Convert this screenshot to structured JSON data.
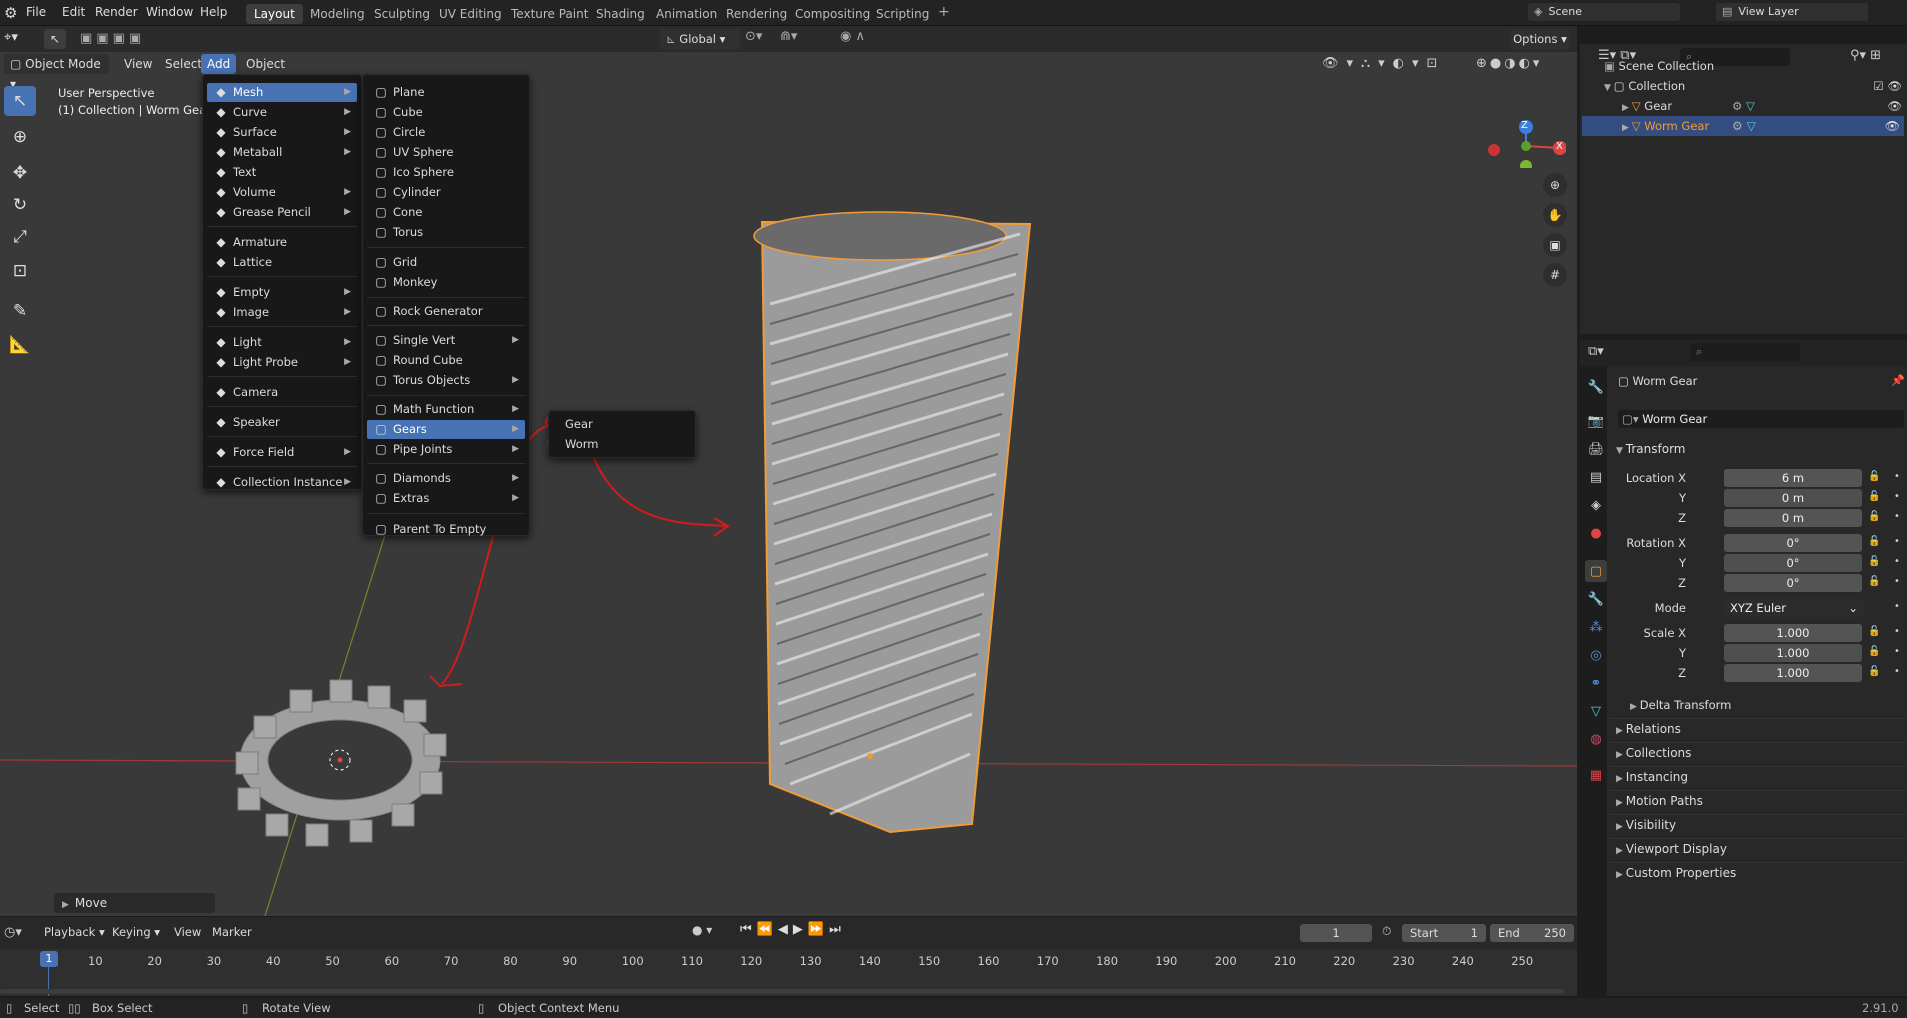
{
  "topbar": {
    "menus": [
      "File",
      "Edit",
      "Render",
      "Window",
      "Help"
    ],
    "workspaces": [
      "Layout",
      "Modeling",
      "Sculpting",
      "UV Editing",
      "Texture Paint",
      "Shading",
      "Animation",
      "Rendering",
      "Compositing",
      "Scripting"
    ],
    "active_workspace": "Layout",
    "scene": "Scene",
    "view_layer": "View Layer"
  },
  "viewport_header": {
    "mode": "Object Mode",
    "menus": [
      "View",
      "Select",
      "Add",
      "Object"
    ],
    "transform_orientation": "Global",
    "options": "Options"
  },
  "viewport": {
    "perspective": "User Perspective",
    "collection_info": "(1) Collection | Worm Gear",
    "operator_panel": "Move",
    "axes": {
      "z": "Z",
      "x": "X"
    }
  },
  "add_menu": {
    "items": [
      {
        "label": "Mesh",
        "icon": "mesh-icon",
        "submenu": true
      },
      {
        "label": "Curve",
        "icon": "curve-icon",
        "submenu": true
      },
      {
        "label": "Surface",
        "icon": "surface-icon",
        "submenu": true
      },
      {
        "label": "Metaball",
        "icon": "metaball-icon",
        "submenu": true
      },
      {
        "label": "Text",
        "icon": "text-icon",
        "submenu": false
      },
      {
        "label": "Volume",
        "icon": "volume-icon",
        "submenu": true
      },
      {
        "label": "Grease Pencil",
        "icon": "grease-pencil-icon",
        "submenu": true
      },
      {
        "label": "Armature",
        "icon": "armature-icon",
        "submenu": false
      },
      {
        "label": "Lattice",
        "icon": "lattice-icon",
        "submenu": false
      },
      {
        "label": "Empty",
        "icon": "empty-icon",
        "submenu": true
      },
      {
        "label": "Image",
        "icon": "image-icon",
        "submenu": true
      },
      {
        "label": "Light",
        "icon": "light-icon",
        "submenu": true
      },
      {
        "label": "Light Probe",
        "icon": "light-probe-icon",
        "submenu": true
      },
      {
        "label": "Camera",
        "icon": "camera-icon",
        "submenu": false
      },
      {
        "label": "Speaker",
        "icon": "speaker-icon",
        "submenu": false
      },
      {
        "label": "Force Field",
        "icon": "force-field-icon",
        "submenu": true
      },
      {
        "label": "Collection Instance",
        "icon": "collection-instance-icon",
        "submenu": true
      }
    ]
  },
  "mesh_menu": {
    "items": [
      {
        "label": "Plane",
        "submenu": false
      },
      {
        "label": "Cube",
        "submenu": false
      },
      {
        "label": "Circle",
        "submenu": false
      },
      {
        "label": "UV Sphere",
        "submenu": false
      },
      {
        "label": "Ico Sphere",
        "submenu": false
      },
      {
        "label": "Cylinder",
        "submenu": false
      },
      {
        "label": "Cone",
        "submenu": false
      },
      {
        "label": "Torus",
        "submenu": false
      },
      {
        "label": "Grid",
        "submenu": false
      },
      {
        "label": "Monkey",
        "submenu": false
      },
      {
        "label": "Rock Generator",
        "submenu": false
      },
      {
        "label": "Single Vert",
        "submenu": true
      },
      {
        "label": "Round Cube",
        "submenu": false
      },
      {
        "label": "Torus Objects",
        "submenu": true
      },
      {
        "label": "Math Function",
        "submenu": true
      },
      {
        "label": "Gears",
        "submenu": true
      },
      {
        "label": "Pipe Joints",
        "submenu": true
      },
      {
        "label": "Diamonds",
        "submenu": true
      },
      {
        "label": "Extras",
        "submenu": true
      },
      {
        "label": "Parent To Empty",
        "submenu": false
      }
    ]
  },
  "gears_menu": {
    "items": [
      "Gear",
      "Worm"
    ]
  },
  "outliner": {
    "root": "Scene Collection",
    "collection": "Collection",
    "objects": [
      "Gear",
      "Worm Gear"
    ],
    "selected": "Worm Gear"
  },
  "properties": {
    "object_name": "Worm Gear",
    "datablock": "Worm Gear",
    "transform_title": "Transform",
    "location_label": "Location X",
    "rotation_label": "Rotation X",
    "scale_label": "Scale X",
    "location": [
      "6 m",
      "0 m",
      "0 m"
    ],
    "rotation": [
      "0°",
      "0°",
      "0°"
    ],
    "scale": [
      "1.000",
      "1.000",
      "1.000"
    ],
    "axis_y": "Y",
    "axis_z": "Z",
    "mode_label": "Mode",
    "mode": "XYZ Euler",
    "delta": "Delta Transform",
    "panels": [
      "Relations",
      "Collections",
      "Instancing",
      "Motion Paths",
      "Visibility",
      "Viewport Display",
      "Custom Properties"
    ]
  },
  "timeline": {
    "menus": [
      "Playback",
      "Keying",
      "View",
      "Marker"
    ],
    "current_frame": "1",
    "start_label": "Start",
    "start": "1",
    "end_label": "End",
    "end": "250",
    "ticks": [
      "1",
      "10",
      "20",
      "30",
      "40",
      "50",
      "60",
      "70",
      "80",
      "90",
      "100",
      "110",
      "120",
      "130",
      "140",
      "150",
      "160",
      "170",
      "180",
      "190",
      "200",
      "210",
      "220",
      "230",
      "240",
      "250"
    ]
  },
  "status_bar": {
    "select": "Select",
    "box_select": "Box Select",
    "rotate": "Rotate View",
    "context": "Object Context Menu",
    "version": "2.91.0"
  },
  "colors": {
    "accent": "#4772b3",
    "selection_outline": "#f29b37",
    "annotation": "#d41b1b"
  }
}
